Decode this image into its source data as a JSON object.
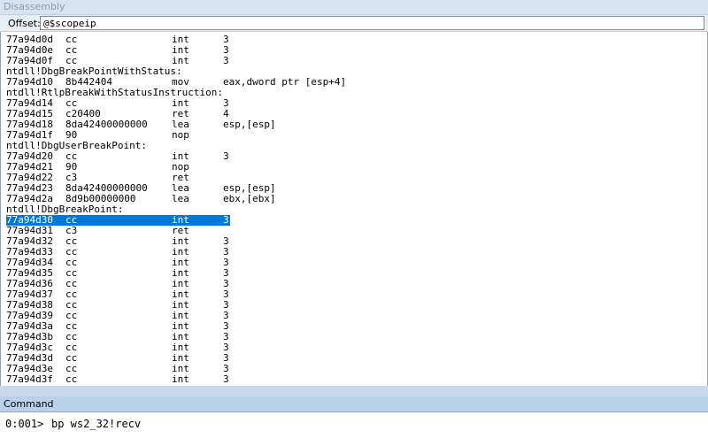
{
  "window": {
    "title": "Disassembly"
  },
  "offset": {
    "label": "Offset:",
    "value": "@$scopeip"
  },
  "selected_index": 13,
  "lines": [
    {
      "kind": "ins",
      "addr": "77a94d0d",
      "bytes": "cc",
      "mnemonic": "int",
      "operands": "3"
    },
    {
      "kind": "ins",
      "addr": "77a94d0e",
      "bytes": "cc",
      "mnemonic": "int",
      "operands": "3"
    },
    {
      "kind": "ins",
      "addr": "77a94d0f",
      "bytes": "cc",
      "mnemonic": "int",
      "operands": "3"
    },
    {
      "kind": "label",
      "text": "ntdll!DbgBreakPointWithStatus:"
    },
    {
      "kind": "ins",
      "addr": "77a94d10",
      "bytes": "8b442404",
      "mnemonic": "mov",
      "operands": "eax,dword ptr [esp+4]"
    },
    {
      "kind": "label",
      "text": "ntdll!RtlpBreakWithStatusInstruction:"
    },
    {
      "kind": "ins",
      "addr": "77a94d14",
      "bytes": "cc",
      "mnemonic": "int",
      "operands": "3"
    },
    {
      "kind": "ins",
      "addr": "77a94d15",
      "bytes": "c20400",
      "mnemonic": "ret",
      "operands": "4"
    },
    {
      "kind": "ins",
      "addr": "77a94d18",
      "bytes": "8da42400000000",
      "mnemonic": "lea",
      "operands": "esp,[esp]"
    },
    {
      "kind": "ins",
      "addr": "77a94d1f",
      "bytes": "90",
      "mnemonic": "nop",
      "operands": ""
    },
    {
      "kind": "label",
      "text": "ntdll!DbgUserBreakPoint:"
    },
    {
      "kind": "ins",
      "addr": "77a94d20",
      "bytes": "cc",
      "mnemonic": "int",
      "operands": "3"
    },
    {
      "kind": "ins",
      "addr": "77a94d21",
      "bytes": "90",
      "mnemonic": "nop",
      "operands": ""
    },
    {
      "kind": "ins",
      "addr": "77a94d22",
      "bytes": "c3",
      "mnemonic": "ret",
      "operands": ""
    },
    {
      "kind": "ins",
      "addr": "77a94d23",
      "bytes": "8da42400000000",
      "mnemonic": "lea",
      "operands": "esp,[esp]"
    },
    {
      "kind": "ins",
      "addr": "77a94d2a",
      "bytes": "8d9b00000000",
      "mnemonic": "lea",
      "operands": "ebx,[ebx]"
    },
    {
      "kind": "label",
      "text": "ntdll!DbgBreakPoint:"
    },
    {
      "kind": "ins",
      "addr": "77a94d30",
      "bytes": "cc",
      "mnemonic": "int",
      "operands": "3",
      "selected": true
    },
    {
      "kind": "ins",
      "addr": "77a94d31",
      "bytes": "c3",
      "mnemonic": "ret",
      "operands": ""
    },
    {
      "kind": "ins",
      "addr": "77a94d32",
      "bytes": "cc",
      "mnemonic": "int",
      "operands": "3"
    },
    {
      "kind": "ins",
      "addr": "77a94d33",
      "bytes": "cc",
      "mnemonic": "int",
      "operands": "3"
    },
    {
      "kind": "ins",
      "addr": "77a94d34",
      "bytes": "cc",
      "mnemonic": "int",
      "operands": "3"
    },
    {
      "kind": "ins",
      "addr": "77a94d35",
      "bytes": "cc",
      "mnemonic": "int",
      "operands": "3"
    },
    {
      "kind": "ins",
      "addr": "77a94d36",
      "bytes": "cc",
      "mnemonic": "int",
      "operands": "3"
    },
    {
      "kind": "ins",
      "addr": "77a94d37",
      "bytes": "cc",
      "mnemonic": "int",
      "operands": "3"
    },
    {
      "kind": "ins",
      "addr": "77a94d38",
      "bytes": "cc",
      "mnemonic": "int",
      "operands": "3"
    },
    {
      "kind": "ins",
      "addr": "77a94d39",
      "bytes": "cc",
      "mnemonic": "int",
      "operands": "3"
    },
    {
      "kind": "ins",
      "addr": "77a94d3a",
      "bytes": "cc",
      "mnemonic": "int",
      "operands": "3"
    },
    {
      "kind": "ins",
      "addr": "77a94d3b",
      "bytes": "cc",
      "mnemonic": "int",
      "operands": "3"
    },
    {
      "kind": "ins",
      "addr": "77a94d3c",
      "bytes": "cc",
      "mnemonic": "int",
      "operands": "3"
    },
    {
      "kind": "ins",
      "addr": "77a94d3d",
      "bytes": "cc",
      "mnemonic": "int",
      "operands": "3"
    },
    {
      "kind": "ins",
      "addr": "77a94d3e",
      "bytes": "cc",
      "mnemonic": "int",
      "operands": "3"
    },
    {
      "kind": "ins",
      "addr": "77a94d3f",
      "bytes": "cc",
      "mnemonic": "int",
      "operands": "3"
    }
  ],
  "command": {
    "title": "Command",
    "prompt": "0:001>",
    "value": "bp ws2_32!recv"
  },
  "colors": {
    "selection": "#0078d7",
    "pane_title_bg": "#b9d1ea",
    "frame": "#c9d9eb"
  }
}
